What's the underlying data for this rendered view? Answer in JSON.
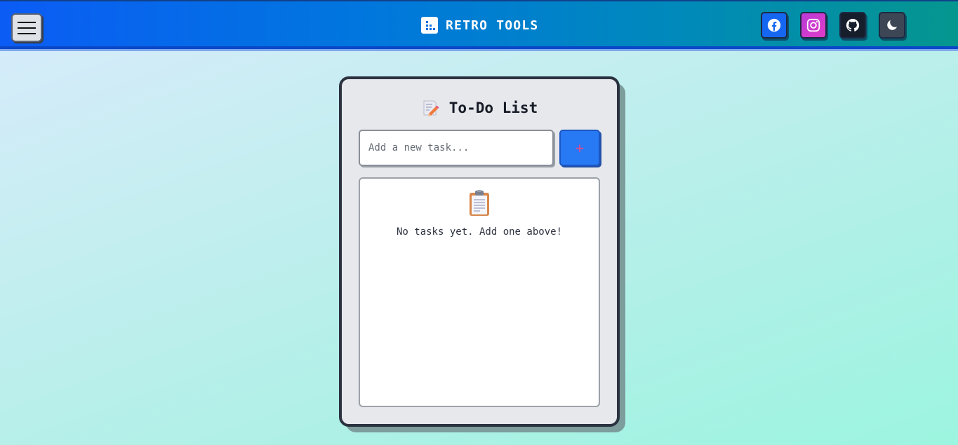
{
  "navbar": {
    "brand": "RETRO TOOLS",
    "menu_icon": "hamburger-menu-icon",
    "social_links": [
      {
        "name": "facebook",
        "icon": "facebook-icon",
        "color": "#1566f0"
      },
      {
        "name": "instagram",
        "icon": "instagram-icon",
        "color": "#c83dcf"
      },
      {
        "name": "github",
        "icon": "github-icon",
        "color": "#161d2b"
      }
    ],
    "theme_toggle_icon": "moon-icon"
  },
  "todo": {
    "title": "To-Do List",
    "title_icon": "memo-pencil-icon",
    "input_placeholder": "Add a new task...",
    "input_value": "",
    "add_button_label": "+",
    "empty_icon": "clipboard-icon",
    "empty_message": "No tasks yet. Add one above!",
    "tasks": []
  },
  "colors": {
    "accent": "#2779f4",
    "header_start": "#0b5cf5",
    "header_end": "#05968f"
  }
}
